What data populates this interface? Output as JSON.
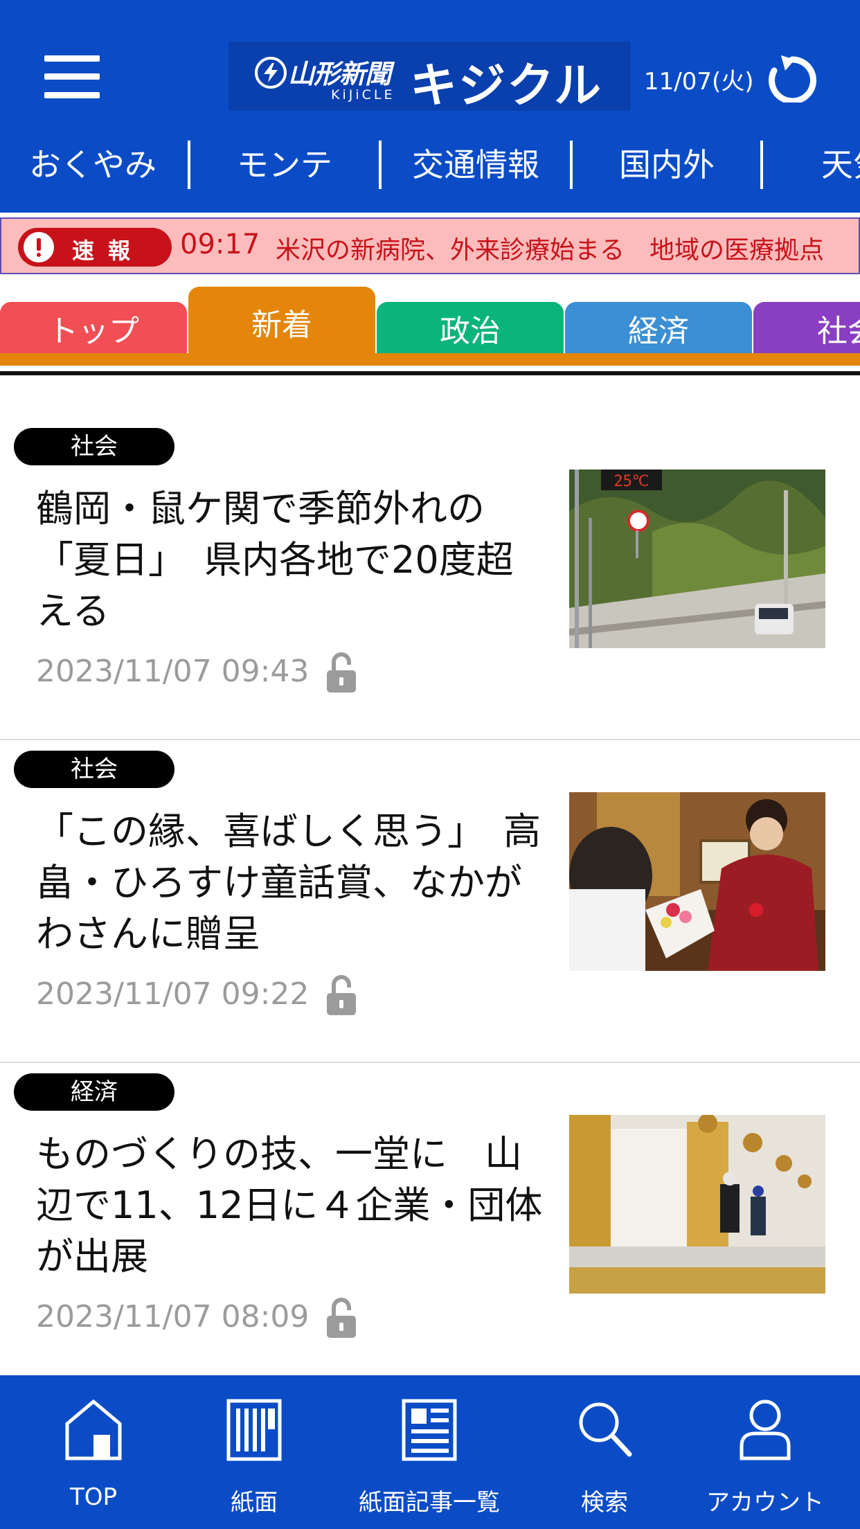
{
  "header": {
    "logo_paper": "山形新聞",
    "logo_sub": "KiJiCLE",
    "logo_name": "キジクル",
    "date": "11/07(火)",
    "brand_color": "#0b4cc6"
  },
  "categories": [
    "おくやみ",
    "モンテ",
    "交通情報",
    "国内外",
    "天気"
  ],
  "breaking": {
    "badge": "速報",
    "time": "09:17",
    "text": "米沢の新病院、外来診療始まる　地域の医療拠点"
  },
  "tabs": [
    {
      "label": "トップ",
      "color": "#f24e55"
    },
    {
      "label": "新着",
      "color": "#e3860b",
      "active": true
    },
    {
      "label": "政治",
      "color": "#0bb47a"
    },
    {
      "label": "経済",
      "color": "#3b8fd4"
    },
    {
      "label": "社会",
      "color": "#8a3fc2"
    }
  ],
  "articles": [
    {
      "genre": "社会",
      "headline": "鶴岡・鼠ケ関で季節外れの「夏日」　県内各地で20度超える",
      "timestamp": "2023/11/07 09:43",
      "thumb_text": "25℃"
    },
    {
      "genre": "社会",
      "headline": "「この縁、喜ばしく思う」　高畠・ひろすけ童話賞、なかがわさんに贈呈",
      "timestamp": "2023/11/07 09:22"
    },
    {
      "genre": "経済",
      "headline": "ものづくりの技、一堂に　山辺で11、12日に４企業・団体が出展",
      "timestamp": "2023/11/07 08:09"
    }
  ],
  "bottom_nav": [
    {
      "label": "TOP",
      "icon": "home-icon"
    },
    {
      "label": "紙面",
      "icon": "newspaper-icon"
    },
    {
      "label": "紙面記事一覧",
      "icon": "article-list-icon"
    },
    {
      "label": "検索",
      "icon": "search-icon"
    },
    {
      "label": "アカウント",
      "icon": "account-icon"
    }
  ]
}
